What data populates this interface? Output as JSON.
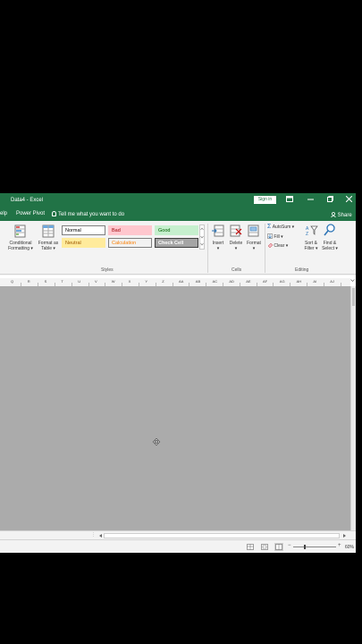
{
  "window": {
    "title": "Data4  -  Excel",
    "signin_label": "Sign in"
  },
  "tabs": [
    "elp",
    "Power Pivot"
  ],
  "tell_me": "Tell me what you want to do",
  "share_label": "Share",
  "ribbon": {
    "conditional_formatting": "Conditional\nFormatting ▾",
    "format_as_table": "Format as\nTable ▾",
    "styles": [
      {
        "label": "Normal",
        "bg": "#ffffff",
        "color": "#000000",
        "border": "#7f7f7f"
      },
      {
        "label": "Bad",
        "bg": "#ffc7ce",
        "color": "#9c0006",
        "border": "#ffc7ce"
      },
      {
        "label": "Good",
        "bg": "#c6efce",
        "color": "#006100",
        "border": "#c6efce"
      },
      {
        "label": "Neutral",
        "bg": "#ffeb9c",
        "color": "#9c5700",
        "border": "#ffeb9c"
      },
      {
        "label": "Calculation",
        "bg": "#f2f2f2",
        "color": "#fa7d00",
        "border": "#7f7f7f"
      },
      {
        "label": "Check Cell",
        "bg": "#a5a5a5",
        "color": "#ffffff",
        "border": "#3f3f3f"
      }
    ],
    "insert": "Insert\n▾",
    "delete": "Delete\n▾",
    "format": "Format\n▾",
    "autosum": "AutoSum ▾",
    "fill": "Fill ▾",
    "clear": "Clear ▾",
    "sort_filter": "Sort &\nFilter ▾",
    "find_select": "Find &\nSelect ▾",
    "groups": {
      "styles": "Styles",
      "cells": "Cells",
      "editing": "Editing"
    }
  },
  "columns": [
    "Q",
    "R",
    "S",
    "T",
    "U",
    "V",
    "W",
    "X",
    "Y",
    "Z",
    "AA",
    "AB",
    "AC",
    "AD",
    "AE",
    "AF",
    "AG",
    "AH",
    "AI",
    "AJ"
  ],
  "zoom": "60%",
  "colors": {
    "excel_green": "#217346",
    "sheet_gray": "#ababab"
  }
}
